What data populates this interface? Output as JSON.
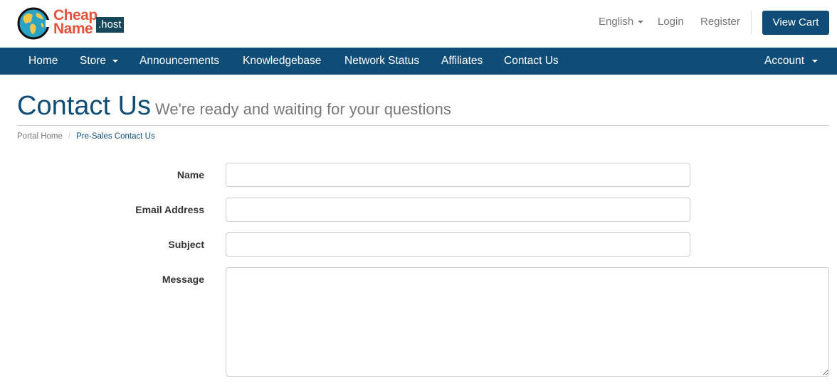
{
  "brand": {
    "line1": "Cheap",
    "line2": "Name",
    "tld": ".host",
    "colors": {
      "accent": "#e8523a",
      "tld_bg": "#17485a",
      "primary": "#0f4d77"
    }
  },
  "header": {
    "language": "English",
    "login": "Login",
    "register": "Register",
    "view_cart": "View Cart"
  },
  "nav": {
    "items": [
      {
        "label": "Home"
      },
      {
        "label": "Store"
      },
      {
        "label": "Announcements"
      },
      {
        "label": "Knowledgebase"
      },
      {
        "label": "Network Status"
      },
      {
        "label": "Affiliates"
      },
      {
        "label": "Contact Us"
      }
    ],
    "account": "Account"
  },
  "page": {
    "title": "Contact Us",
    "subtitle": "We're ready and waiting for your questions",
    "breadcrumb": {
      "home": "Portal Home",
      "sep": "/",
      "current": "Pre-Sales Contact Us"
    }
  },
  "form": {
    "name_label": "Name",
    "name_value": "",
    "email_label": "Email Address",
    "email_value": "",
    "subject_label": "Subject",
    "subject_value": "",
    "message_label": "Message",
    "message_value": ""
  }
}
